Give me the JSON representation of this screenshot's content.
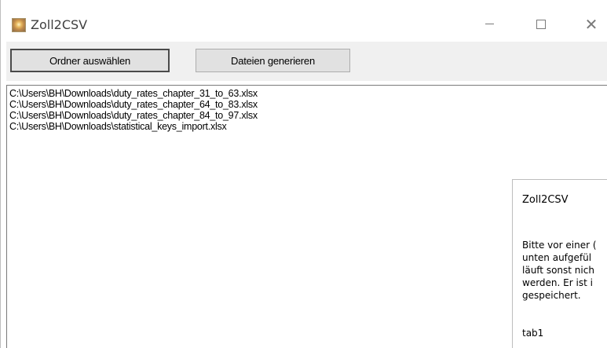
{
  "window": {
    "title": "Zoll2CSV",
    "minimize_icon": "minimize-icon",
    "maximize_icon": "maximize-icon",
    "close_icon": "close-icon",
    "close_glyph": "✕"
  },
  "toolbar": {
    "select_folder_label": "Ordner auswählen",
    "generate_files_label": "Dateien generieren"
  },
  "file_list": {
    "items": [
      "C:\\Users\\BH\\Downloads\\duty_rates_chapter_31_to_63.xlsx",
      "C:\\Users\\BH\\Downloads\\duty_rates_chapter_64_to_83.xlsx",
      "C:\\Users\\BH\\Downloads\\duty_rates_chapter_84_to_97.xlsx",
      "C:\\Users\\BH\\Downloads\\statistical_keys_import.xlsx"
    ]
  },
  "dialog": {
    "title": "Zoll2CSV",
    "message_lines": [
      "Bitte vor einer (",
      "unten aufgefül",
      "läuft sonst nich",
      "werden. Er ist i",
      "gespeichert."
    ],
    "tab_label": "tab1"
  },
  "colors": {
    "toolbar_bg": "#f0f0f0",
    "button_bg": "#e1e1e1",
    "button_border": "#adadad"
  }
}
